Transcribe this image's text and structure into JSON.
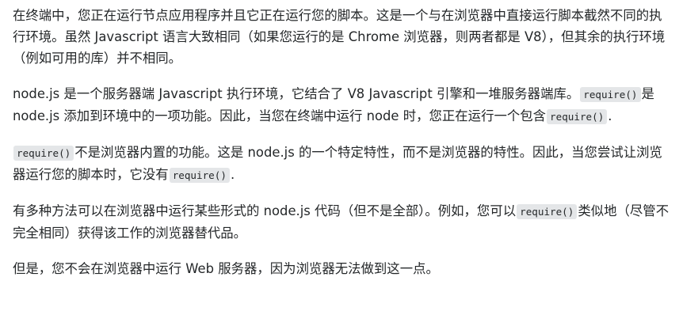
{
  "paragraphs": [
    [
      {
        "text": "在终端中，您正在运行节点应用程序并且它正在运行您的脚本。这是一个与在浏览器中直接运行脚本截然不同的执行环境。虽然 Javascript 语言大致相同（如果您运行的是 Chrome 浏览器，则两者都是 V8），但其余的执行环境（例如可用的库）并不相同。"
      }
    ],
    [
      {
        "text": "node.js 是一个服务器端 Javascript 执行环境，它结合了 V8 Javascript 引擎和一堆服务器端库。"
      },
      {
        "code": "require()"
      },
      {
        "text": "是 node.js 添加到环境中的一项功能。因此，当您在终端中运行 node 时，您正在运行一个包含"
      },
      {
        "code": "require()"
      },
      {
        "text": "."
      }
    ],
    [
      {
        "code": "require()"
      },
      {
        "text": "不是浏览器内置的功能。这是 node.js 的一个特定特性，而不是浏览器的特性。因此，当您尝试让浏览器运行您的脚本时，它没有"
      },
      {
        "code": "require()"
      },
      {
        "text": "."
      }
    ],
    [
      {
        "text": "有多种方法可以在浏览器中运行某些形式的 node.js 代码（但不是全部）。例如，您可以"
      },
      {
        "code": "require()"
      },
      {
        "text": "类似地（尽管不完全相同）获得该工作的浏览器替代品。"
      }
    ],
    [
      {
        "text": "但是，您不会在浏览器中运行 Web 服务器，因为浏览器无法做到这一点。"
      }
    ]
  ]
}
